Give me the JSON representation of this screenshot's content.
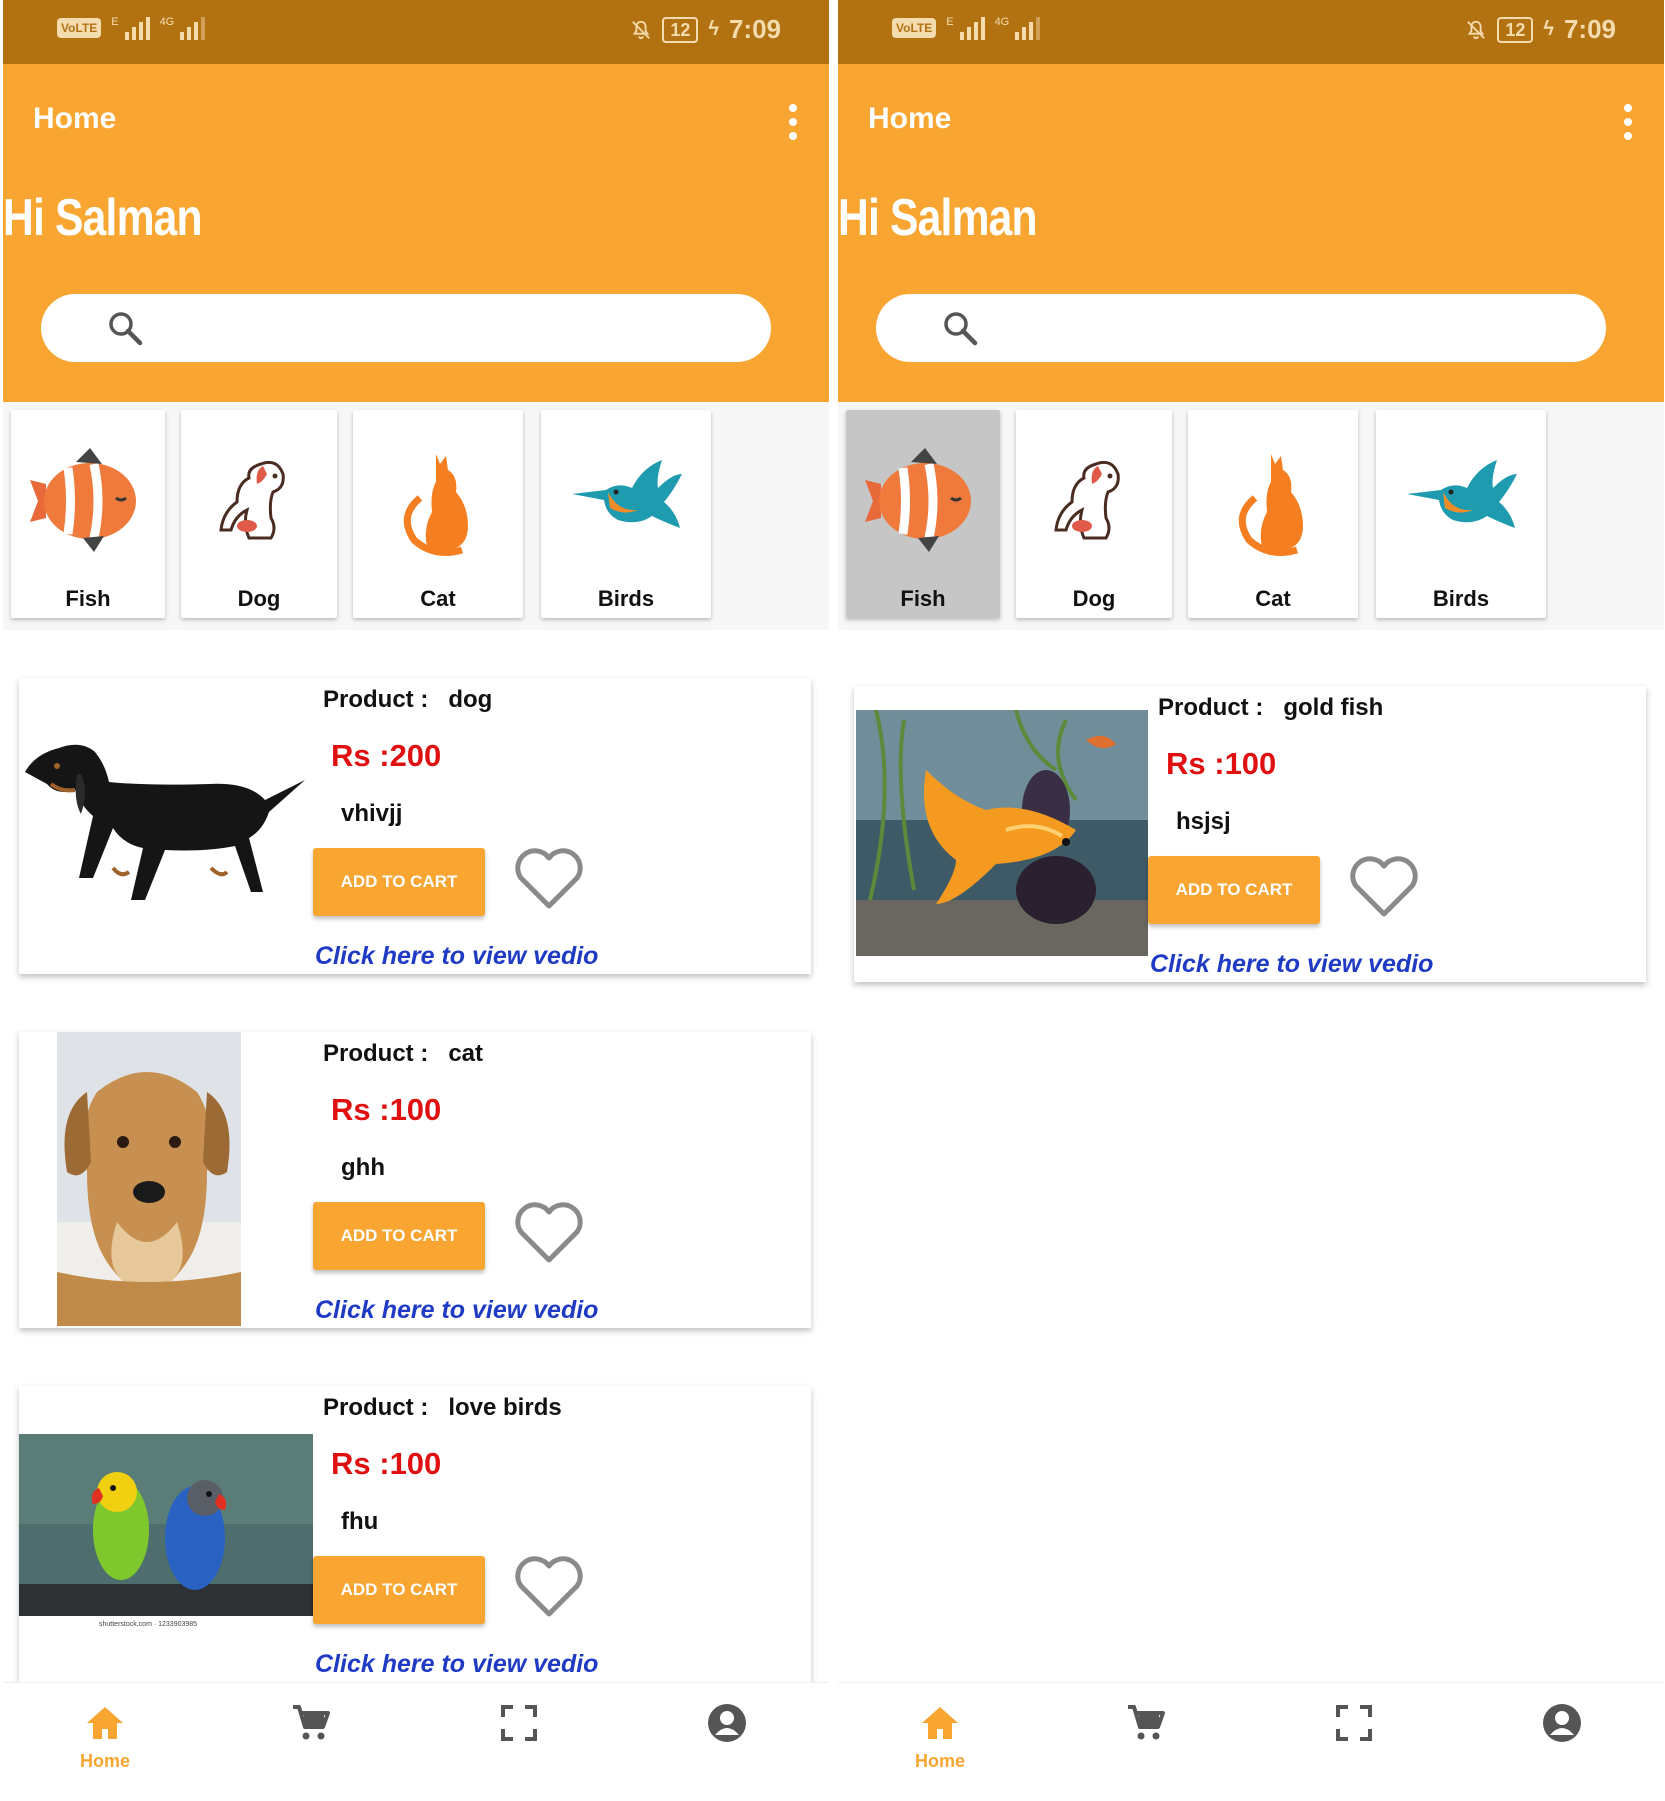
{
  "colors": {
    "status_bar": "#b37212",
    "accent": "#f8a531",
    "price": "#e01010",
    "link": "#1f3bc4",
    "selected_tile": "#c6c6c6"
  },
  "screens": [
    {
      "status": {
        "volte": "VoLTE",
        "network_1": "E",
        "network_2": "4G",
        "battery": "12",
        "time": "7:09"
      },
      "app_bar": {
        "title": "Home"
      },
      "greeting": "Hi Salman",
      "search": {
        "placeholder": ""
      },
      "categories": [
        {
          "label": "Fish",
          "icon": "fish-icon",
          "selected": false
        },
        {
          "label": "Dog",
          "icon": "dog-icon",
          "selected": false
        },
        {
          "label": "Cat",
          "icon": "cat-icon",
          "selected": false
        },
        {
          "label": "Birds",
          "icon": "bird-icon",
          "selected": false
        }
      ],
      "products": [
        {
          "name_label": "Product :",
          "name": "dog",
          "price": "Rs :200",
          "description": "vhivjj",
          "button": "ADD TO CART",
          "link": "Click here to view vedio",
          "image": "dachshund-photo"
        },
        {
          "name_label": "Product :",
          "name": "cat",
          "price": "Rs :100",
          "description": "ghh",
          "button": "ADD TO CART",
          "link": "Click here to view vedio",
          "image": "puppy-photo"
        },
        {
          "name_label": "Product :",
          "name": "love birds",
          "price": "Rs :100",
          "description": "fhu",
          "button": "ADD TO CART",
          "link": "Click here to view vedio",
          "image": "lovebirds-photo",
          "image_caption": "shutterstock.com · 1233903985"
        }
      ],
      "bottom_nav": [
        {
          "label": "Home",
          "icon": "home-icon",
          "active": true
        },
        {
          "label": "",
          "icon": "cart-icon",
          "active": false
        },
        {
          "label": "",
          "icon": "scan-icon",
          "active": false
        },
        {
          "label": "",
          "icon": "profile-icon",
          "active": false
        }
      ]
    },
    {
      "status": {
        "volte": "VoLTE",
        "network_1": "E",
        "network_2": "4G",
        "battery": "12",
        "time": "7:09"
      },
      "app_bar": {
        "title": "Home"
      },
      "greeting": "Hi Salman",
      "search": {
        "placeholder": ""
      },
      "categories": [
        {
          "label": "Fish",
          "icon": "fish-icon",
          "selected": true
        },
        {
          "label": "Dog",
          "icon": "dog-icon",
          "selected": false
        },
        {
          "label": "Cat",
          "icon": "cat-icon",
          "selected": false
        },
        {
          "label": "Birds",
          "icon": "bird-icon",
          "selected": false
        }
      ],
      "products": [
        {
          "name_label": "Product :",
          "name": "gold fish",
          "price": "Rs :100",
          "description": "hsjsj",
          "button": "ADD TO CART",
          "link": "Click here to view vedio",
          "image": "goldfish-photo"
        }
      ],
      "bottom_nav": [
        {
          "label": "Home",
          "icon": "home-icon",
          "active": true
        },
        {
          "label": "",
          "icon": "cart-icon",
          "active": false
        },
        {
          "label": "",
          "icon": "scan-icon",
          "active": false
        },
        {
          "label": "",
          "icon": "profile-icon",
          "active": false
        }
      ]
    }
  ]
}
